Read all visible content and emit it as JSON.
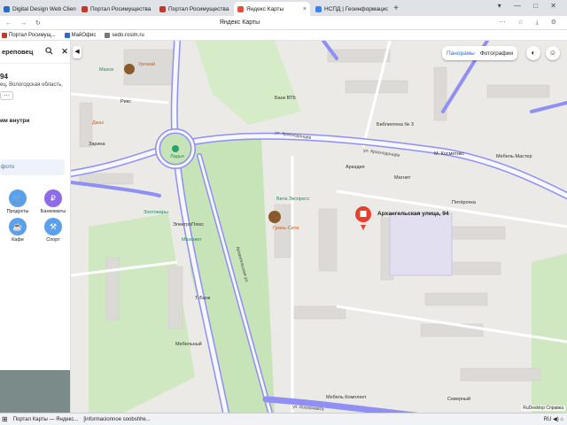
{
  "browser": {
    "tabs": [
      {
        "label": "Digital Design Web Client",
        "color": "#2b6cc4"
      },
      {
        "label": "Портал Росимущества",
        "color": "#c0392b"
      },
      {
        "label": "Портал Росимущества",
        "color": "#c0392b"
      },
      {
        "label": "Яндекс Карты",
        "color": "#e74c3c",
        "active": true
      },
      {
        "label": "НСПД | Геоинформацио",
        "color": "#3b82f6"
      }
    ],
    "new_tab": "+",
    "window_controls": "▾ — □ ✕",
    "page_title": "Яндекс Карты",
    "nav": "← → ↻",
    "toolbar_right": "⋯ ☆ ⤓ ⚙"
  },
  "bookmarks": [
    {
      "label": "Портал Росимущ...",
      "color": "#c0392b"
    },
    {
      "label": "МайОфис",
      "color": "#2b6cc4"
    },
    {
      "label": "sedo.rosim.ru",
      "color": "#777777"
    }
  ],
  "sidebar": {
    "search_text": "ереповец",
    "heading": "94",
    "address_line": "ец, Вологодская область,",
    "more": "⋯",
    "inside": "им внутри",
    "photo_btn": "фото",
    "categories": [
      {
        "label": "Продукты",
        "glyph": "🛒",
        "color": "#5aa0ec"
      },
      {
        "label": "Банкоматы",
        "glyph": "₽",
        "color": "#8e6be8"
      },
      {
        "label": "Кафе",
        "glyph": "☕",
        "color": "#5aa0ec"
      },
      {
        "label": "Спорт",
        "glyph": "⚒",
        "color": "#5aa0ec"
      }
    ]
  },
  "map": {
    "mode_toggle": {
      "panoramas": "Панорамы",
      "photos": "Фотографии"
    },
    "pin_label": "Архангельская улица, 94",
    "labels": [
      {
        "t": "Махси",
        "cls": "green"
      },
      {
        "t": "Урожай",
        "cls": "orange"
      },
      {
        "t": "Рикс",
        "cls": ""
      },
      {
        "t": "Банк ВТБ",
        "cls": ""
      },
      {
        "t": "Джаз",
        "cls": "orange"
      },
      {
        "t": "Зарина",
        "cls": ""
      },
      {
        "t": "Библиотека № 3",
        "cls": ""
      },
      {
        "t": "ул. Краснодонцев",
        "cls": "road"
      },
      {
        "t": "ул. Краснодонцев",
        "cls": "road"
      },
      {
        "t": "Ладья",
        "cls": "green"
      },
      {
        "t": "Аркадия",
        "cls": ""
      },
      {
        "t": "М. Косметикс",
        "cls": ""
      },
      {
        "t": "Мебель-Мастер",
        "cls": ""
      },
      {
        "t": "Магнит",
        "cls": ""
      },
      {
        "t": "Вита Экспресс",
        "cls": "green"
      },
      {
        "t": "Пятёрочка",
        "cls": ""
      },
      {
        "t": "Зоотовары",
        "cls": "green"
      },
      {
        "t": "Архангельская ул.",
        "cls": "road"
      },
      {
        "t": "Гриль-Сити",
        "cls": "orange"
      },
      {
        "t": "ЭлектроПлюс",
        "cls": ""
      },
      {
        "t": "Махсимт",
        "cls": "green"
      },
      {
        "t": "Т-Банк",
        "cls": ""
      },
      {
        "t": "Мебельный",
        "cls": ""
      },
      {
        "t": "Мебель Комплект",
        "cls": ""
      },
      {
        "t": "Северный",
        "cls": ""
      },
      {
        "t": "ул. Космонавта",
        "cls": "road"
      }
    ],
    "copyright": "RuDesktop  Справка"
  },
  "taskbar": {
    "items": [
      "Портал Карты — Яндекс...",
      "[informacionnoe soobshhe..."
    ],
    "tray": "RU  ◀)  ⌂"
  },
  "colors": {
    "accent": "#2a6fd6",
    "road": "#8f8ff5",
    "park": "#c7e3b8",
    "pin": "#e8402f"
  }
}
